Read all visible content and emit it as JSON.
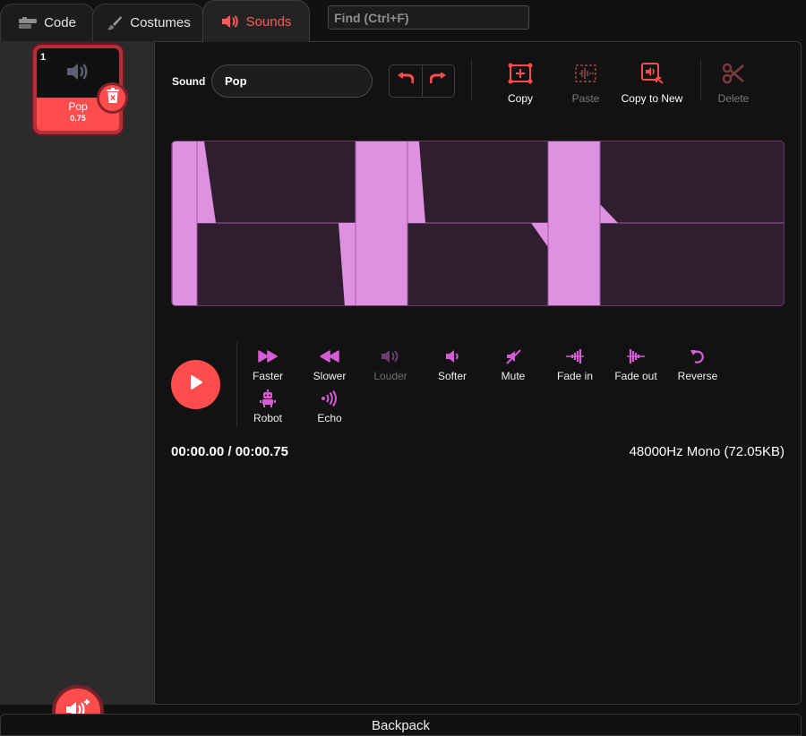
{
  "tabs": {
    "code": "Code",
    "costumes": "Costumes",
    "sounds": "Sounds"
  },
  "find": {
    "placeholder": "Find (Ctrl+F)"
  },
  "sound_list": [
    {
      "index": "1",
      "name": "Pop",
      "duration": "0.75",
      "selected": true
    }
  ],
  "editor": {
    "sound_label": "Sound",
    "sound_name": "Pop",
    "tools": {
      "copy": "Copy",
      "paste": "Paste",
      "copy_to_new": "Copy to New",
      "delete": "Delete"
    },
    "effects": {
      "faster": "Faster",
      "slower": "Slower",
      "louder": "Louder",
      "softer": "Softer",
      "mute": "Mute",
      "fade_in": "Fade in",
      "fade_out": "Fade out",
      "reverse": "Reverse",
      "robot": "Robot",
      "echo": "Echo"
    },
    "time": "00:00.00 / 00:00.75",
    "format": "48000Hz Mono (72.05KB)"
  },
  "backpack": "Backpack",
  "colors": {
    "accent": "#ff4c4c",
    "effect": "#d65cd6",
    "waveform": "#dd8fe0",
    "background": "#111111"
  }
}
